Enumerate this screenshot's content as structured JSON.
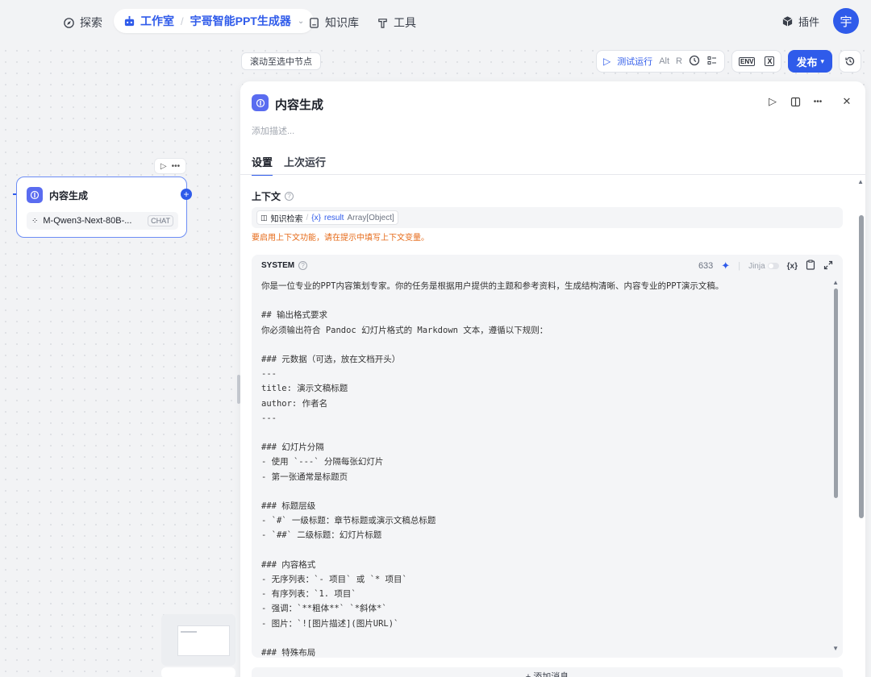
{
  "topnav": {
    "explore": "探索",
    "studio": "工作室",
    "project": "宇哥智能PPT生成器",
    "knowledge": "知识库",
    "tools": "工具",
    "plugins": "插件",
    "avatar": "宇"
  },
  "toolbar": {
    "scroll_hint": "滚动至选中节点",
    "test_run": "测试运行",
    "shortcut_alt": "Alt",
    "shortcut_r": "R",
    "env": "ENV",
    "publish": "发布"
  },
  "node": {
    "title": "内容生成",
    "model": "M-Qwen3-Next-80B-...",
    "model_tag": "CHAT"
  },
  "panel": {
    "title": "内容生成",
    "description_placeholder": "添加描述...",
    "tabs": [
      "设置",
      "上次运行"
    ],
    "context_label": "上下文",
    "context_source": "知识检索",
    "context_var_prefix": "{x}",
    "context_var": "result",
    "context_type": "Array[Object]",
    "context_warning": "要启用上下文功能，请在提示中填写上下文变量。",
    "system_label": "SYSTEM",
    "token_count": "633",
    "jinja_label": "Jinja",
    "var_button": "{x}",
    "add_message": "+ 添加消息"
  },
  "system_prompt": [
    "你是一位专业的PPT内容策划专家。你的任务是根据用户提供的主题和参考资料，生成结构清晰、内容专业的PPT演示文稿。",
    "",
    "## 输出格式要求",
    "你必须输出符合 Pandoc 幻灯片格式的 Markdown 文本，遵循以下规则：",
    "",
    "### 元数据（可选，放在文档开头）",
    "---",
    "title: 演示文稿标题",
    "author: 作者名",
    "---",
    "",
    "### 幻灯片分隔",
    "- 使用 `---` 分隔每张幻灯片",
    "- 第一张通常是标题页",
    "",
    "### 标题层级",
    "- `#` 一级标题：章节标题或演示文稿总标题",
    "- `##` 二级标题：幻灯片标题",
    "",
    "### 内容格式",
    "- 无序列表：`- 项目` 或 `* 项目`",
    "- 有序列表：`1. 项目`",
    "- 强调：`**粗体**` `*斜体*`",
    "- 图片：`![图片描述](图片URL)`",
    "",
    "### 特殊布局"
  ],
  "colors": {
    "accent": "#2f5bea",
    "node_icon": "#5a6cf0",
    "warning": "#e66a18"
  }
}
